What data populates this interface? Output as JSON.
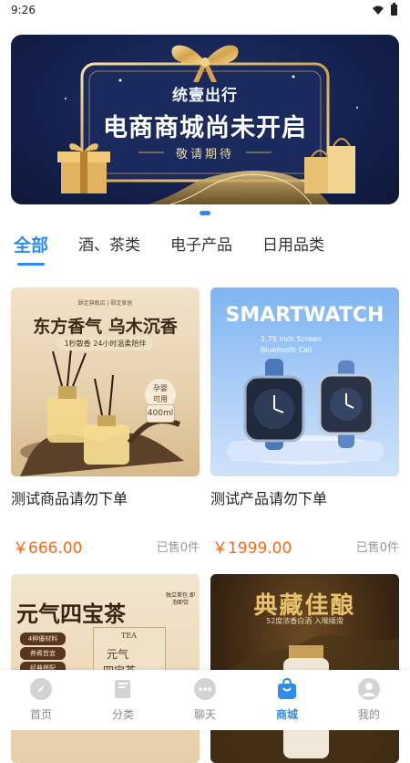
{
  "status_bar": {
    "time": "9:26"
  },
  "banner": {
    "subtitle": "统壹出行",
    "title": "电商商城尚未开启",
    "tagline": "敬请期待"
  },
  "categories": [
    {
      "label": "全部",
      "active": true
    },
    {
      "label": "酒、茶类",
      "active": false
    },
    {
      "label": "电子产品",
      "active": false
    },
    {
      "label": "日用品类",
      "active": false
    }
  ],
  "products": [
    {
      "name": "测试商品请勿下单",
      "price": "￥666.00",
      "sold": "已售0件",
      "image_text": {
        "top": "颐定旗舰店 | 颐定家居",
        "title": "东方香气 乌木沉香",
        "band": "1秒散香 24小时温柔陪伴",
        "badge_line1": "孕婴",
        "badge_line2": "可用",
        "volume": "400ml"
      }
    },
    {
      "name": "测试产品请勿下单",
      "price": "￥1999.00",
      "sold": "已售0件",
      "image_text": {
        "title": "SMARTWATCH",
        "line1": "1.75 inch Screen",
        "line2": "Bluetooth Call"
      }
    },
    {
      "name": "",
      "image_text": {
        "title": "元气四宝茶",
        "tag1": "4种優材料",
        "tag2": "养煮皆宜",
        "tag3": "经典搭配",
        "box_label": "TEA",
        "box_text1": "元气",
        "box_text2": "四宝茶",
        "note": "独立茶包 即泡即饮"
      }
    },
    {
      "name": "",
      "image_text": {
        "title": "典藏佳酿",
        "subtitle": "52度浓香白酒 入喉顺滑"
      }
    }
  ],
  "tab_bar": [
    {
      "label": "首页",
      "icon": "compass-icon",
      "active": false
    },
    {
      "label": "分类",
      "icon": "book-icon",
      "active": false
    },
    {
      "label": "聊天",
      "icon": "chat-bubble-icon",
      "active": false
    },
    {
      "label": "商城",
      "icon": "shopping-bag-icon",
      "active": true
    },
    {
      "label": "我的",
      "icon": "user-avatar-icon",
      "active": false
    }
  ],
  "colors": {
    "accent": "#2d8cf0",
    "price": "#f06b1d"
  }
}
